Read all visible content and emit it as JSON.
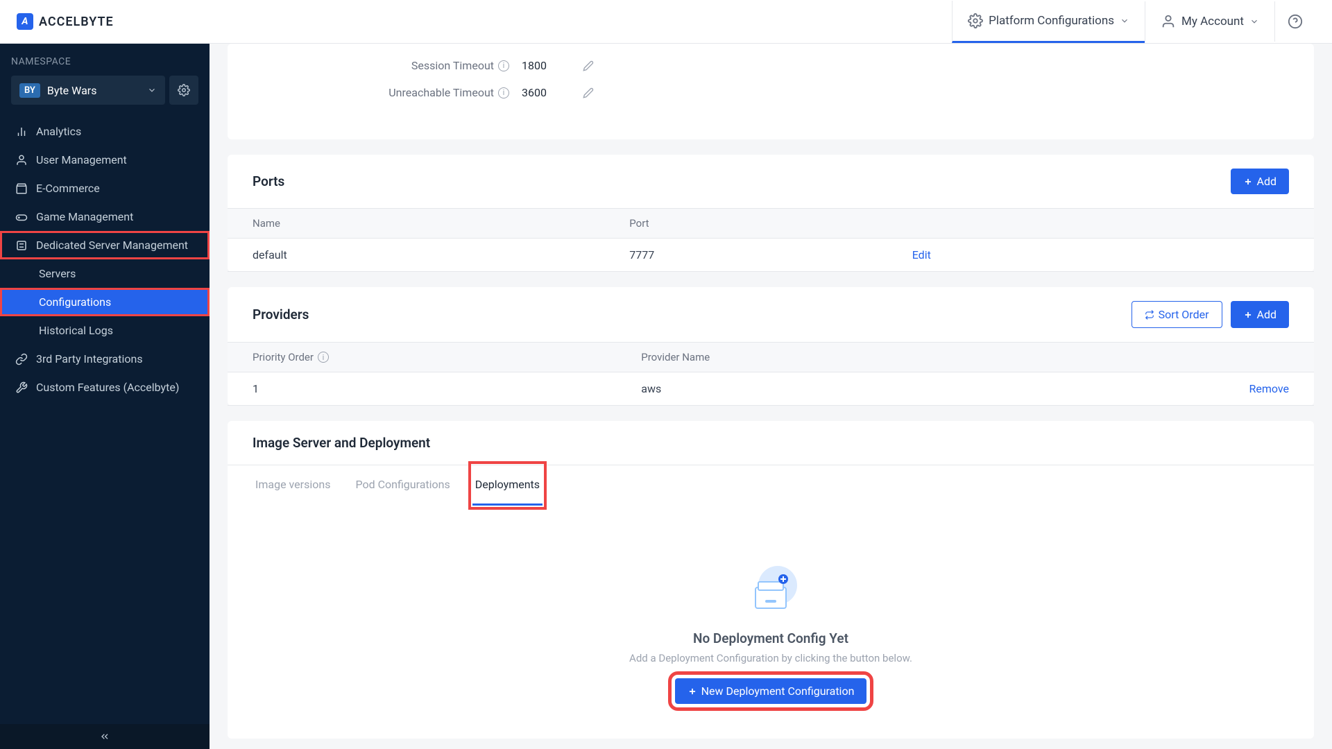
{
  "brand": "ACCELBYTE",
  "header": {
    "platform_config": "Platform Configurations",
    "my_account": "My Account"
  },
  "sidebar": {
    "ns_label": "NAMESPACE",
    "ns_badge": "BY",
    "ns_name": "Byte Wars",
    "items": [
      "Analytics",
      "User Management",
      "E-Commerce",
      "Game Management",
      "Dedicated Server Management",
      "3rd Party Integrations",
      "Custom Features (Accelbyte)"
    ],
    "dsm_sub": [
      "Servers",
      "Configurations",
      "Historical Logs"
    ]
  },
  "config": {
    "session_timeout_label": "Session Timeout",
    "session_timeout_value": "1800",
    "unreachable_timeout_label": "Unreachable Timeout",
    "unreachable_timeout_value": "3600"
  },
  "ports": {
    "title": "Ports",
    "add": "Add",
    "col_name": "Name",
    "col_port": "Port",
    "row_name": "default",
    "row_port": "7777",
    "edit": "Edit"
  },
  "providers": {
    "title": "Providers",
    "sort": "Sort Order",
    "add": "Add",
    "col_priority": "Priority Order",
    "col_provider": "Provider Name",
    "row_priority": "1",
    "row_provider": "aws",
    "remove": "Remove"
  },
  "deploy": {
    "title": "Image Server and Deployment",
    "tabs": [
      "Image versions",
      "Pod Configurations",
      "Deployments"
    ],
    "empty_title": "No Deployment Config Yet",
    "empty_sub": "Add a Deployment Configuration by clicking the button below.",
    "new_btn": "New Deployment Configuration"
  }
}
